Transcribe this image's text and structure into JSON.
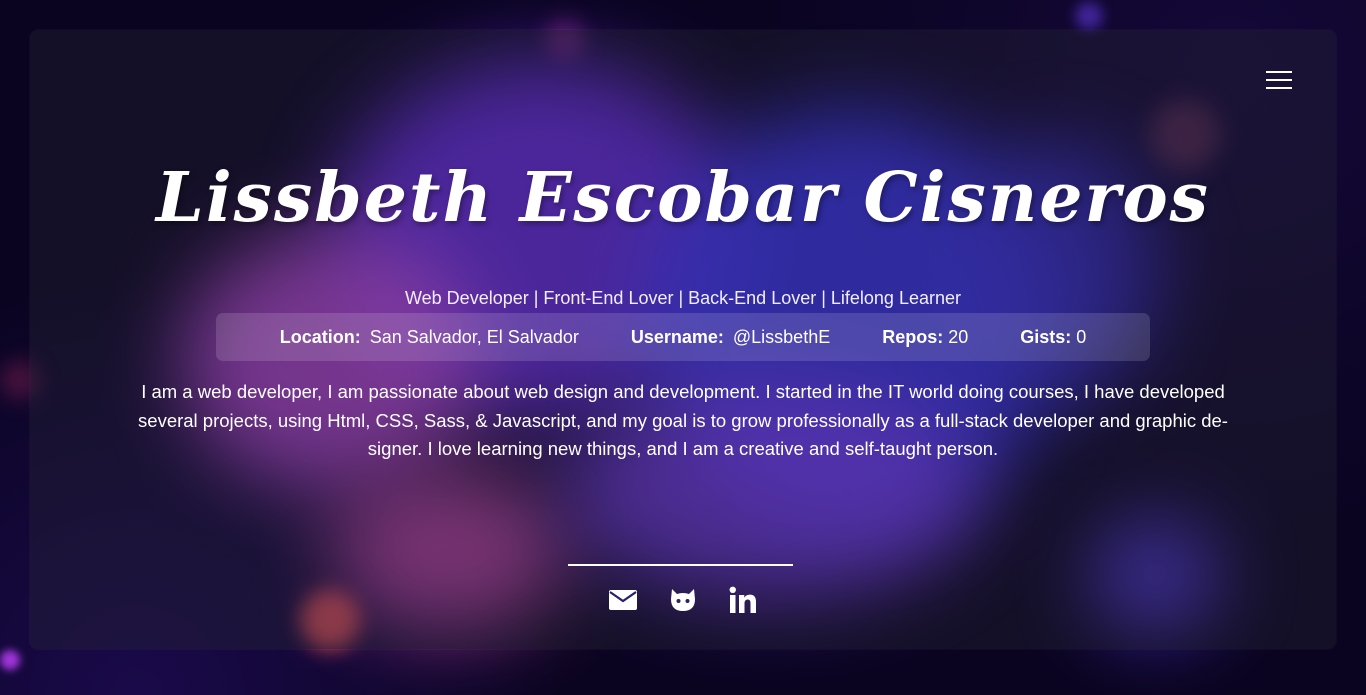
{
  "profile": {
    "name": "Lissbeth Escobar Cisneros",
    "tagline": "Web Developer | Front-End Lover | Back-End Lover | Lifelong Learner",
    "bio": "I am a web developer, I am passionate about web design and development. I started in the IT world doing courses, I have developed several projects, using Html, CSS, Sass, & Javascript, and my goal is to grow professionally as a full-stack developer and graphic de-signer. I love learning new things, and I am a creative and self-taught person."
  },
  "info": {
    "location_label": "Location:",
    "location_value": "San Salvador, El Salvador",
    "username_label": "Username:",
    "username_value": "@LissbethE",
    "repos_label": "Repos:",
    "repos_value": "20",
    "gists_label": "Gists:",
    "gists_value": "0"
  },
  "menu": {
    "icon": "hamburger-menu-icon"
  },
  "socials": [
    {
      "name": "email",
      "icon": "envelope-icon"
    },
    {
      "name": "github",
      "icon": "github-icon"
    },
    {
      "name": "linkedin",
      "icon": "linkedin-icon"
    }
  ],
  "colors": {
    "background": "#0a0420",
    "accent_purple": "#6d2cf0",
    "accent_blue": "#3b34f5",
    "accent_pink": "#c24be0",
    "text": "#ffffff"
  }
}
